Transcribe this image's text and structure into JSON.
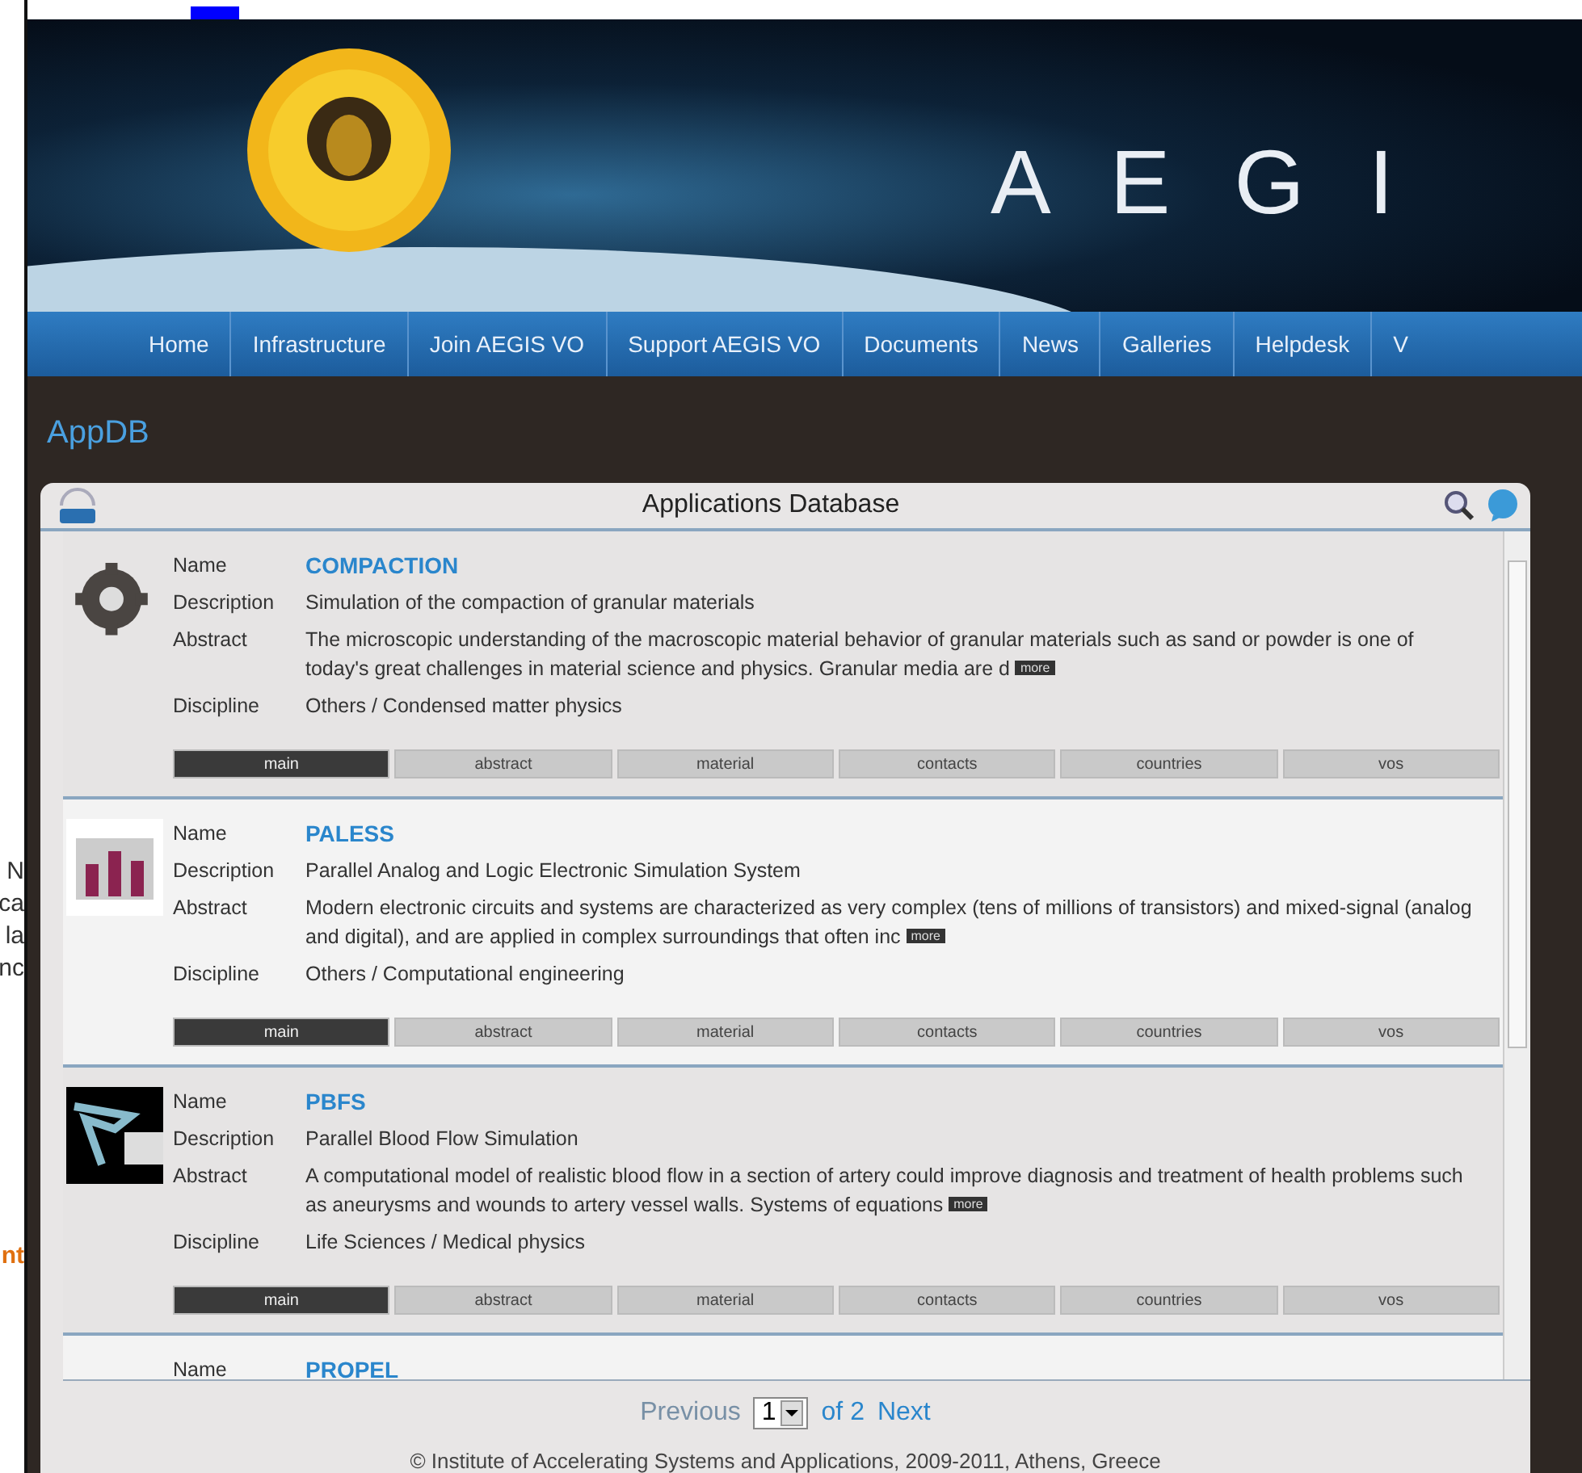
{
  "left_fragments": [
    {
      "text": "N",
      "kind": "plain"
    },
    {
      "text": "ca",
      "kind": "plain"
    },
    {
      "text": "la",
      "kind": "plain"
    },
    {
      "text": "nc",
      "kind": "plain"
    },
    {
      "text": "nt",
      "kind": "accent"
    }
  ],
  "banner": {
    "title": "A E G I"
  },
  "nav": [
    "Home",
    "Infrastructure",
    "Join AEGIS VO",
    "Support AEGIS VO",
    "Documents",
    "News",
    "Galleries",
    "Helpdesk",
    "V"
  ],
  "page_title": "AppDB",
  "panel": {
    "title": "Applications Database",
    "apps": [
      {
        "kind": "gear",
        "labels": {
          "name": "Name",
          "description": "Description",
          "abstract": "Abstract",
          "discipline": "Discipline"
        },
        "more": "more",
        "name": "COMPACTION",
        "description": "Simulation of the compaction of granular materials",
        "abstract": "The microscopic understanding of the macroscopic material behavior of granular materials such as sand or powder is one of today's great challenges in material science and physics. Granular media are d",
        "discipline": "Others / Condensed matter physics",
        "tabs": [
          {
            "label": "main",
            "selected": true
          },
          {
            "label": "abstract",
            "selected": false
          },
          {
            "label": "material",
            "selected": false
          },
          {
            "label": "contacts",
            "selected": false
          },
          {
            "label": "countries",
            "selected": false
          },
          {
            "label": "vos",
            "selected": false
          }
        ]
      },
      {
        "kind": "chart",
        "labels": {
          "name": "Name",
          "description": "Description",
          "abstract": "Abstract",
          "discipline": "Discipline"
        },
        "more": "more",
        "name": "PALESS",
        "description": "Parallel Analog and Logic Electronic Simulation System",
        "abstract": "Modern electronic circuits and systems are characterized as very complex (tens of millions of transistors) and mixed-signal (analog and digital), and are applied in complex surroundings that often inc",
        "discipline": "Others / Computational engineering",
        "tabs": [
          {
            "label": "main",
            "selected": true
          },
          {
            "label": "abstract",
            "selected": false
          },
          {
            "label": "material",
            "selected": false
          },
          {
            "label": "contacts",
            "selected": false
          },
          {
            "label": "countries",
            "selected": false
          },
          {
            "label": "vos",
            "selected": false
          }
        ]
      },
      {
        "kind": "vessel",
        "labels": {
          "name": "Name",
          "description": "Description",
          "abstract": "Abstract",
          "discipline": "Discipline"
        },
        "more": "more",
        "name": "PBFS",
        "description": "Parallel Blood Flow Simulation",
        "abstract": "A computational model of realistic blood flow in a section of artery could improve diagnosis and treatment of health problems such as aneurysms and wounds to artery vessel walls. Systems of equations",
        "discipline": "Life Sciences / Medical physics",
        "tabs": [
          {
            "label": "main",
            "selected": true
          },
          {
            "label": "abstract",
            "selected": false
          },
          {
            "label": "material",
            "selected": false
          },
          {
            "label": "contacts",
            "selected": false
          },
          {
            "label": "countries",
            "selected": false
          },
          {
            "label": "vos",
            "selected": false
          }
        ]
      },
      {
        "kind": "blank",
        "labels": {
          "name": "Name"
        },
        "name": "PROPEL"
      }
    ],
    "pager": {
      "previous": {
        "label": "Previous",
        "disabled": true
      },
      "page": "1",
      "of": "of 2",
      "next": {
        "label": "Next",
        "disabled": false
      }
    },
    "footer": "© Institute of Accelerating Systems and Applications, 2009-2011, Athens, Greece"
  }
}
